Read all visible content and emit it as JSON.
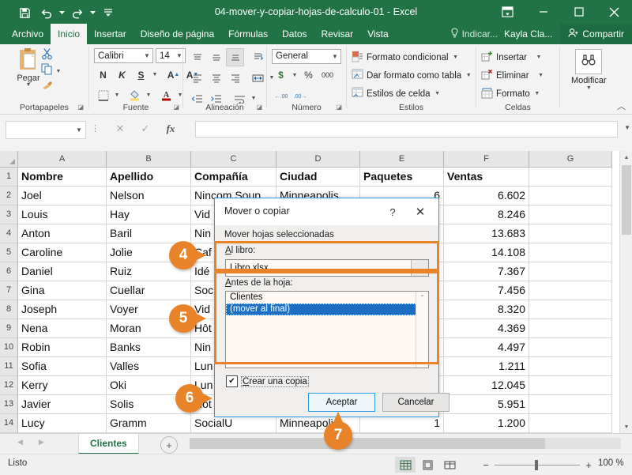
{
  "window": {
    "title": "04-mover-y-copiar-hojas-de-calculo-01  -  Excel",
    "quick_access": [
      "save-icon",
      "undo-icon",
      "redo-icon",
      "customize-qat-icon"
    ],
    "controls": [
      "ribbon-display-options-icon",
      "minimize-icon",
      "maximize-icon",
      "close-icon"
    ]
  },
  "ribbon": {
    "tabs": [
      {
        "label": "Archivo",
        "active": false
      },
      {
        "label": "Inicio",
        "active": true
      },
      {
        "label": "Insertar",
        "active": false
      },
      {
        "label": "Diseño de página",
        "active": false
      },
      {
        "label": "Fórmulas",
        "active": false
      },
      {
        "label": "Datos",
        "active": false
      },
      {
        "label": "Revisar",
        "active": false
      },
      {
        "label": "Vista",
        "active": false
      }
    ],
    "tell_me": "Indicar...",
    "user": "Kayla Cla...",
    "share": "Compartir",
    "groups": {
      "clipboard": {
        "label": "Portapapeles",
        "paste": "Pegar"
      },
      "font": {
        "label": "Fuente",
        "font_name": "Calibri",
        "font_size": "14",
        "bold": "N",
        "italic": "K",
        "underline": "S",
        "grow": "A",
        "shrink": "A"
      },
      "alignment": {
        "label": "Alineación"
      },
      "number": {
        "label": "Número",
        "format": "General",
        "percent": "%",
        "comma": "000",
        "currency": "$"
      },
      "styles": {
        "label": "Estilos",
        "items": [
          "Formato condicional",
          "Dar formato como tabla",
          "Estilos de celda"
        ]
      },
      "cells": {
        "label": "Celdas",
        "items": [
          "Insertar",
          "Eliminar",
          "Formato"
        ]
      },
      "editing": {
        "label": "",
        "modify": "Modificar"
      }
    }
  },
  "formula_bar": {
    "name_box": "",
    "cancel_icon": "cancel-icon",
    "accept_icon": "accept-icon",
    "fx_icon": "fx-icon",
    "formula": ""
  },
  "grid": {
    "columns": [
      "A",
      "B",
      "C",
      "D",
      "E",
      "F",
      "G"
    ],
    "rows": [
      "1",
      "2",
      "3",
      "4",
      "5",
      "6",
      "7",
      "8",
      "9",
      "10",
      "11",
      "12",
      "13",
      "14"
    ],
    "headers": [
      "Nombre",
      "Apellido",
      "Compañía",
      "Ciudad",
      "Paquetes",
      "Ventas",
      ""
    ],
    "data": [
      [
        "Joel",
        "Nelson",
        "Nincom Soup",
        "Minneapolis",
        "6",
        "6.602",
        ""
      ],
      [
        "Louis",
        "Hay",
        "Vid",
        "",
        "",
        "8.246",
        ""
      ],
      [
        "Anton",
        "Baril",
        "Nin",
        "",
        "",
        "13.683",
        ""
      ],
      [
        "Caroline",
        "Jolie",
        "Caf",
        "",
        "",
        "14.108",
        ""
      ],
      [
        "Daniel",
        "Ruiz",
        "Idé",
        "",
        "",
        "7.367",
        ""
      ],
      [
        "Gina",
        "Cuellar",
        "Soc",
        "",
        "",
        "7.456",
        ""
      ],
      [
        "Joseph",
        "Voyer",
        "Vid",
        "",
        "",
        "8.320",
        ""
      ],
      [
        "Nena",
        "Moran",
        "Hôt",
        "",
        "",
        "4.369",
        ""
      ],
      [
        "Robin",
        "Banks",
        "Nin",
        "",
        "",
        "4.497",
        ""
      ],
      [
        "Sofia",
        "Valles",
        "Lun",
        "",
        "",
        "1.211",
        ""
      ],
      [
        "Kerry",
        "Oki",
        "Lun",
        "",
        "",
        "12.045",
        ""
      ],
      [
        "Javier",
        "Solis",
        "Hôt",
        "",
        "",
        "5.951",
        ""
      ],
      [
        "Lucy",
        "Gramm",
        "SocialU",
        "Minneapolis",
        "1",
        "1.200",
        ""
      ]
    ]
  },
  "sheet_tabs": {
    "active": "Clientes",
    "add_label": "+"
  },
  "status_bar": {
    "status": "Listo",
    "zoom": "100 %",
    "views": [
      "normal-view-icon",
      "page-layout-icon",
      "page-break-icon"
    ],
    "zoom_out": "−",
    "zoom_in": "+"
  },
  "dialog": {
    "title": "Mover o copiar",
    "help": "?",
    "close": "✕",
    "subtitle": "Mover hojas seleccionadas",
    "to_book_label": "Al libro:",
    "to_book_value": "Libro.xlsx",
    "before_sheet_label": "Antes de la hoja:",
    "sheet_list": [
      "Clientes",
      "(mover al final)"
    ],
    "selected_sheet": "(mover al final)",
    "create_copy_label": "Crear una copia",
    "create_copy_checked": true,
    "ok": "Aceptar",
    "cancel": "Cancelar"
  },
  "annotations": {
    "accent_color": "#e8832a",
    "markers": [
      {
        "number": "4",
        "direction": "right"
      },
      {
        "number": "5",
        "direction": "right"
      },
      {
        "number": "6",
        "direction": "right"
      },
      {
        "number": "7",
        "direction": "up"
      }
    ]
  },
  "colors": {
    "excel_green": "#217346",
    "selection_blue": "#1e6fc4",
    "highlight_orange": "#e8832a"
  }
}
